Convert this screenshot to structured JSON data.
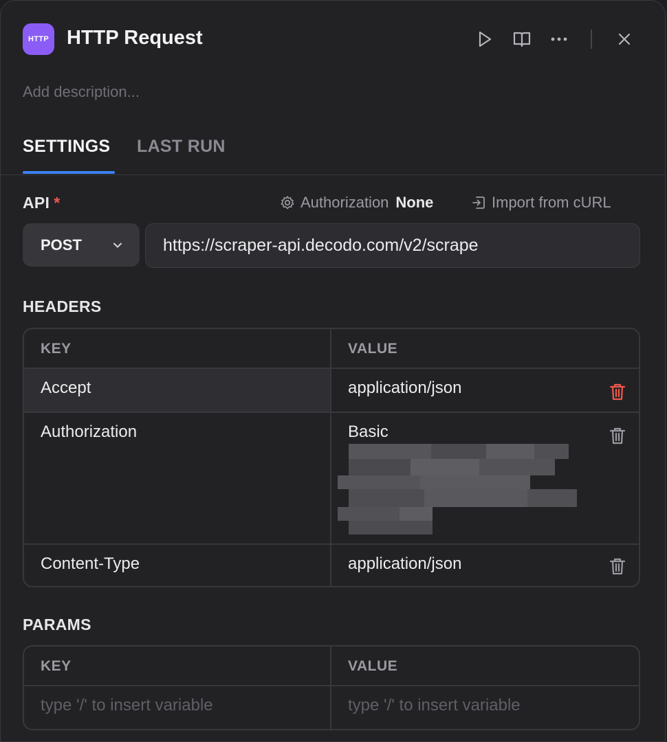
{
  "header": {
    "app_icon_text": "HTTP",
    "title": "HTTP Request",
    "description_placeholder": "Add description..."
  },
  "tabs": [
    {
      "label": "SETTINGS",
      "active": true
    },
    {
      "label": "LAST RUN",
      "active": false
    }
  ],
  "api": {
    "label": "API",
    "required_mark": "*",
    "authorization_label": "Authorization",
    "authorization_value": "None",
    "import_label": "Import from cURL",
    "method": "POST",
    "url": "https://scraper-api.decodo.com/v2/scrape"
  },
  "headers": {
    "label": "HEADERS",
    "columns": [
      "KEY",
      "VALUE"
    ],
    "rows": [
      {
        "key": "Accept",
        "value": "application/json"
      },
      {
        "key": "Authorization",
        "value": "Basic"
      },
      {
        "key": "Content-Type",
        "value": "application/json"
      }
    ]
  },
  "params": {
    "label": "PARAMS",
    "columns": [
      "KEY",
      "VALUE"
    ],
    "key_placeholder": "type '/' to insert variable",
    "value_placeholder": "type '/' to insert variable"
  },
  "colors": {
    "accent": "#3b82f6",
    "app_icon": "#8b5cf6",
    "danger": "#ef5a4f"
  }
}
